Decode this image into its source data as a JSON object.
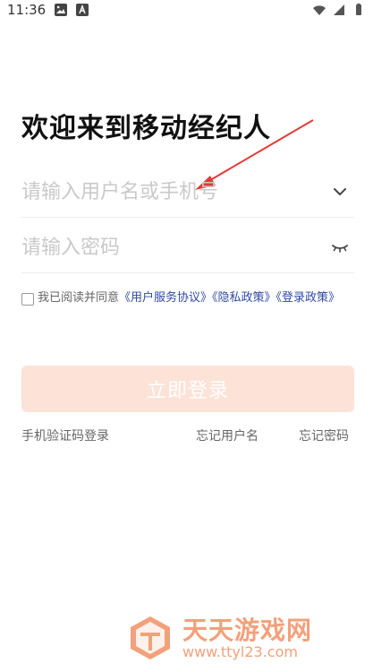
{
  "status_bar": {
    "time": "11:36"
  },
  "login": {
    "title": "欢迎来到移动经纪人",
    "username": {
      "value": "",
      "placeholder": "请输入用户名或手机号",
      "right_icon": "chevron-down-icon"
    },
    "password": {
      "value": "",
      "placeholder": "请输入密码",
      "right_icon": "eye-closed-icon"
    },
    "agreement": {
      "prefix": "我已阅读并同意",
      "user_service": "《用户服务协议》",
      "privacy": "《隐私政策》",
      "login_policy": "《登录政策》"
    },
    "login_button": "立即登录",
    "bottom_links": {
      "sms_login": "手机验证码登录",
      "forgot_username": "忘记用户名",
      "forgot_password": "忘记密码"
    }
  },
  "watermark": {
    "title": "天天游戏网",
    "url": "www.ttyl23.com"
  },
  "colors": {
    "accent_link": "#2f4aa0",
    "button_disabled_bg": "#fde2d7",
    "annotation_red": "#e53935",
    "watermark": "#f3a07b"
  }
}
